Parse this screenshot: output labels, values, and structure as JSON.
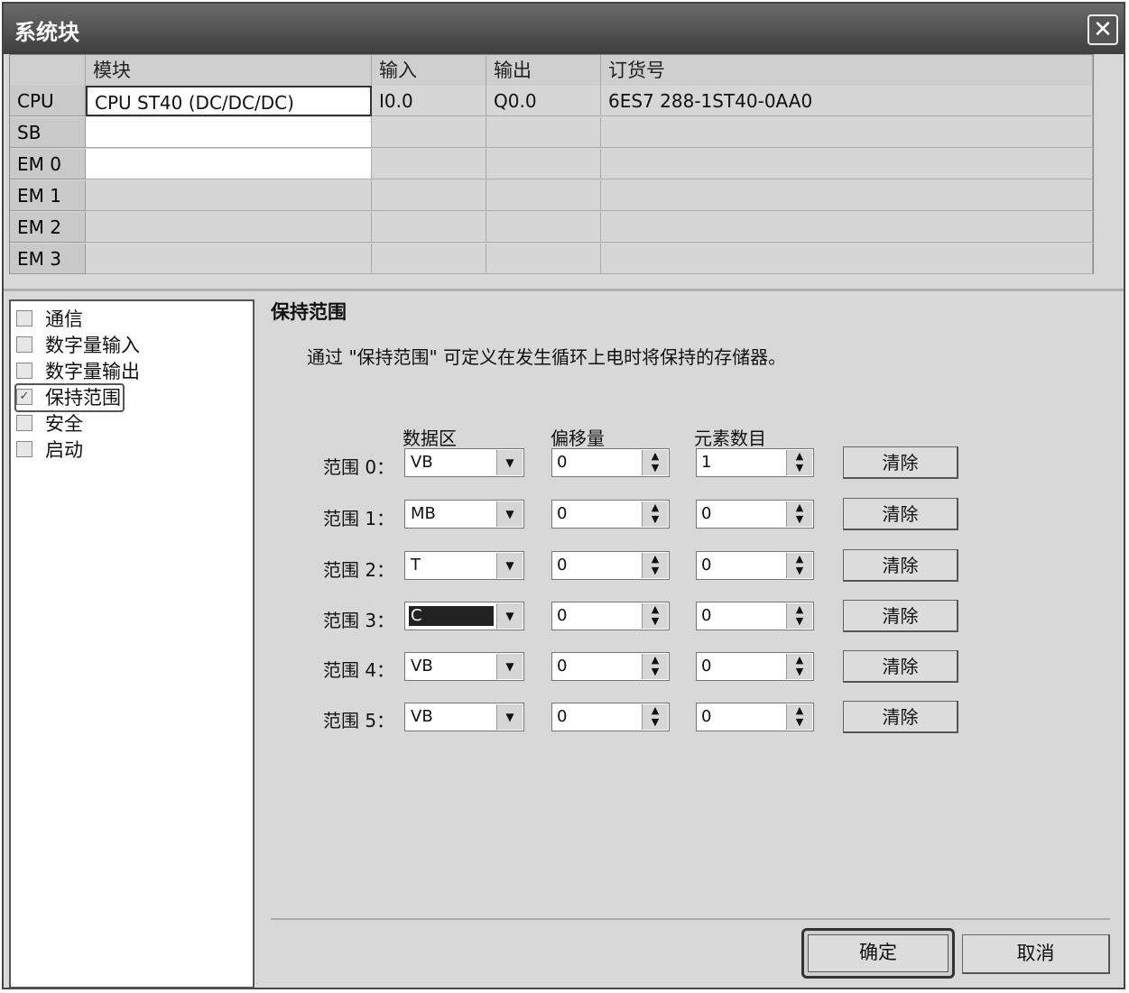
{
  "window": {
    "title": "系统块"
  },
  "module_table": {
    "headers": [
      "模块",
      "输入",
      "输出",
      "订货号"
    ],
    "rows": [
      {
        "label": "CPU",
        "module": "CPU ST40 (DC/DC/DC)",
        "input": "I0.0",
        "output": "Q0.0",
        "order_no": "6ES7 288-1ST40-0AA0"
      },
      {
        "label": "SB",
        "module": "",
        "input": "",
        "output": "",
        "order_no": ""
      },
      {
        "label": "EM 0",
        "module": "",
        "input": "",
        "output": "",
        "order_no": ""
      },
      {
        "label": "EM 1",
        "module": "",
        "input": "",
        "output": "",
        "order_no": ""
      },
      {
        "label": "EM 2",
        "module": "",
        "input": "",
        "output": "",
        "order_no": ""
      },
      {
        "label": "EM 3",
        "module": "",
        "input": "",
        "output": "",
        "order_no": ""
      }
    ]
  },
  "tree": {
    "items": [
      {
        "label": "通信",
        "checked": false
      },
      {
        "label": "数字量输入",
        "checked": false
      },
      {
        "label": "数字量输出",
        "checked": false
      },
      {
        "label": "保持范围",
        "checked": true,
        "selected": true
      },
      {
        "label": "安全",
        "checked": false
      },
      {
        "label": "启动",
        "checked": false
      }
    ]
  },
  "retentive": {
    "title": "保持范围",
    "description": "通过 \"保持范围\" 可定义在发生循环上电时将保持的存储器。",
    "col_headers": {
      "area": "数据区",
      "offset": "偏移量",
      "count": "元素数目"
    },
    "ranges": [
      {
        "label": "范围 0：",
        "area": "VB",
        "offset": "0",
        "count": "1",
        "clear": "清除"
      },
      {
        "label": "范围 1：",
        "area": "MB",
        "offset": "0",
        "count": "0",
        "clear": "清除"
      },
      {
        "label": "范围 2：",
        "area": "T",
        "offset": "0",
        "count": "0",
        "clear": "清除"
      },
      {
        "label": "范围 3：",
        "area": "C",
        "offset": "0",
        "count": "0",
        "clear": "清除"
      },
      {
        "label": "范围 4：",
        "area": "VB",
        "offset": "0",
        "count": "0",
        "clear": "清除"
      },
      {
        "label": "范围 5：",
        "area": "VB",
        "offset": "0",
        "count": "0",
        "clear": "清除"
      }
    ]
  },
  "buttons": {
    "ok": "确定",
    "cancel": "取消"
  }
}
